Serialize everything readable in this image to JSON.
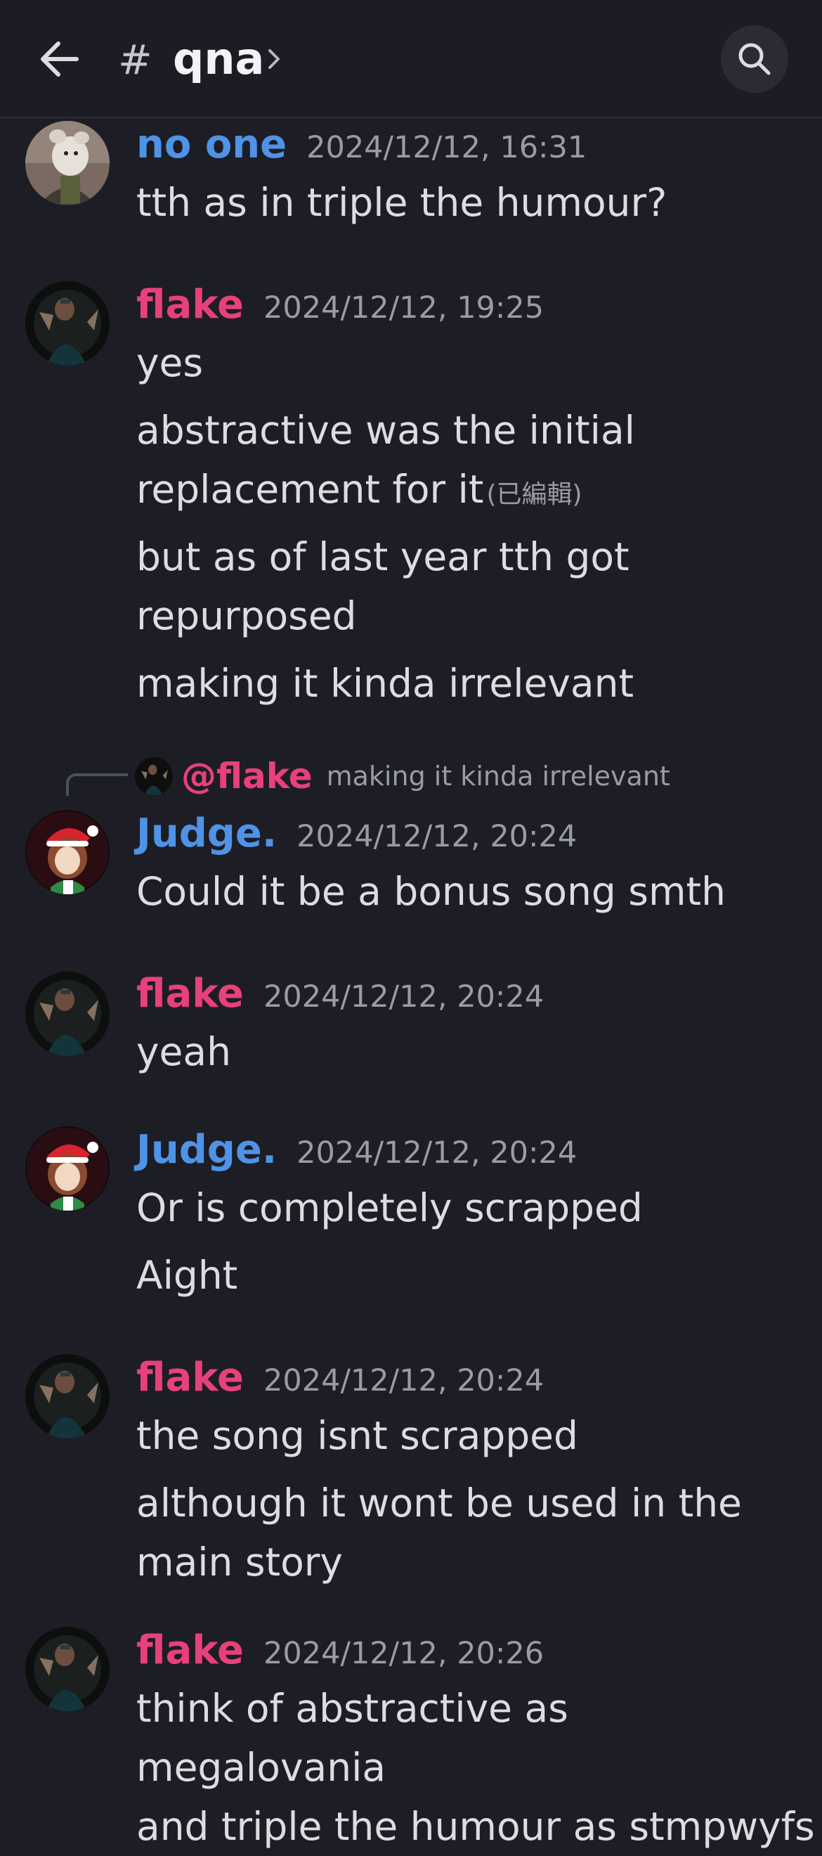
{
  "header": {
    "channel_prefix": "#",
    "channel_name": "qna"
  },
  "messages": [
    {
      "author": "no one",
      "timestamp": "2024/12/12, 16:31",
      "lines": [
        "tth as in triple the humour?"
      ]
    },
    {
      "author": "flake",
      "timestamp": "2024/12/12, 19:25",
      "lines": [
        "yes",
        "abstractive was the initial",
        "replacement for it",
        "but as of last year tth got",
        "repurposed",
        "making it kinda irrelevant"
      ],
      "edited_label": "(已編輯)"
    },
    {
      "reply": {
        "mention": "@flake",
        "text": "making it kinda irrelevant"
      },
      "author": "Judge.",
      "timestamp": "2024/12/12, 20:24",
      "lines": [
        "Could it be a bonus song smth"
      ]
    },
    {
      "author": "flake",
      "timestamp": "2024/12/12, 20:24",
      "lines": [
        "yeah"
      ]
    },
    {
      "author": "Judge.",
      "timestamp": "2024/12/12, 20:24",
      "lines": [
        "Or is completely scrapped",
        "Aight"
      ]
    },
    {
      "author": "flake",
      "timestamp": "2024/12/12, 20:24",
      "lines": [
        "the song isnt scrapped",
        "although it wont be used in the",
        "main story"
      ]
    },
    {
      "author": "flake",
      "timestamp": "2024/12/12, 20:26",
      "lines": [
        "think of abstractive as",
        "megalovania",
        "and triple the humour as stmpwyfs"
      ]
    }
  ],
  "colors": {
    "background": "#1d1d26",
    "author_blue": "#4f93e6",
    "author_pink": "#e8417a",
    "timestamp": "#9a9ba3",
    "text": "#dcdde0"
  },
  "icons": [
    "back-arrow-icon",
    "chevron-right-icon",
    "search-icon"
  ]
}
